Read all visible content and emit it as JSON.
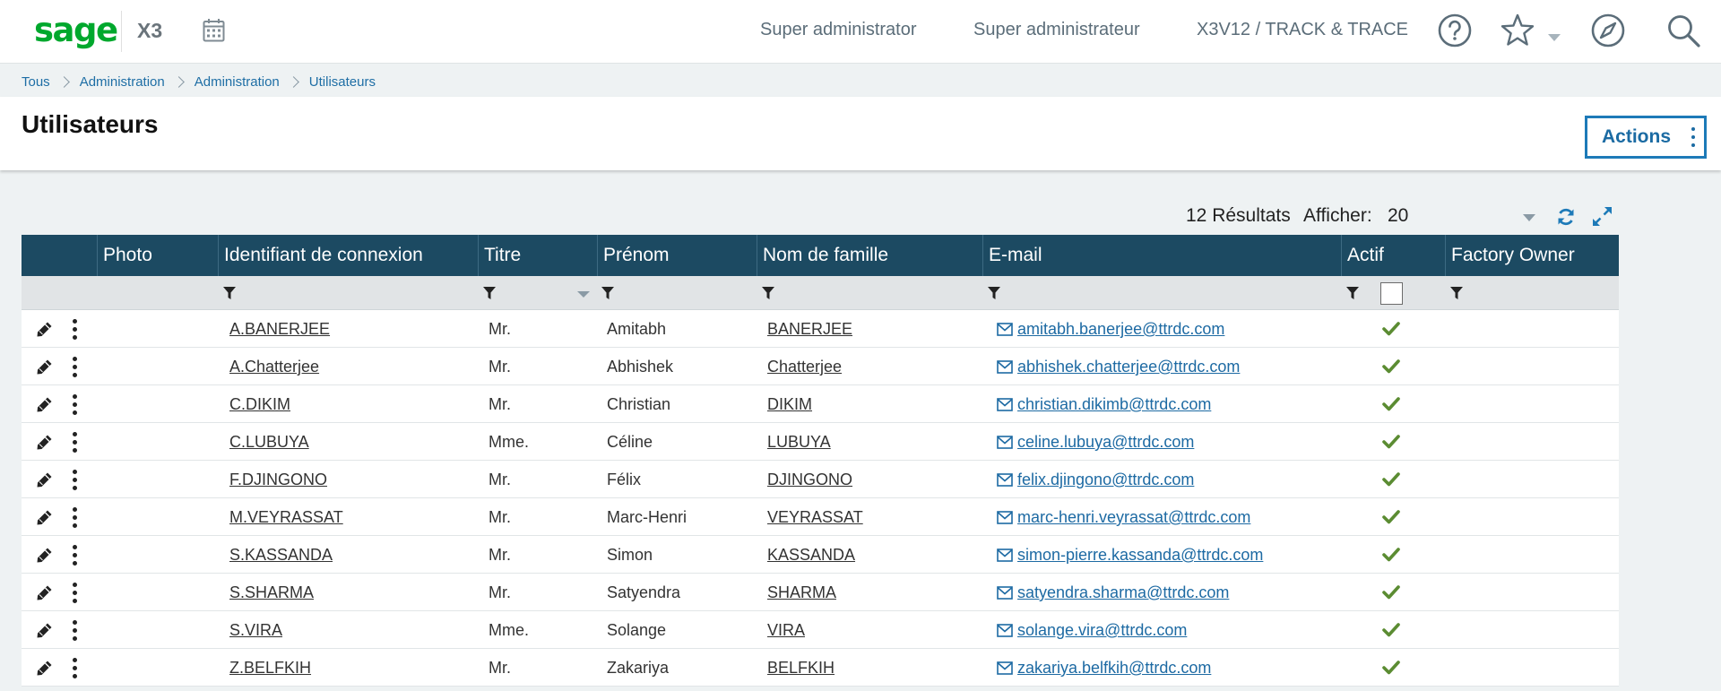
{
  "app": {
    "logo": "sage",
    "name": "X3"
  },
  "topbar": {
    "user": "Super administrator",
    "role": "Super administrateur",
    "endpoint": "X3V12 / TRACK & TRACE"
  },
  "breadcrumb": [
    "Tous",
    "Administration",
    "Administration",
    "Utilisateurs"
  ],
  "page": {
    "title": "Utilisateurs",
    "actions_label": "Actions"
  },
  "results": {
    "count_label": "12 Résultats",
    "show_label": "Afficher:",
    "show_value": "20"
  },
  "columns": [
    "Photo",
    "Identifiant de connexion",
    "Titre",
    "Prénom",
    "Nom de famille",
    "E-mail",
    "Actif",
    "Factory Owner"
  ],
  "rows": [
    {
      "login": "A.BANERJEE",
      "title": "Mr.",
      "first": "Amitabh",
      "last": "BANERJEE",
      "email": "amitabh.banerjee@ttrdc.com",
      "active": true
    },
    {
      "login": "A.Chatterjee",
      "title": "Mr.",
      "first": "Abhishek",
      "last": "Chatterjee",
      "email": "abhishek.chatterjee@ttrdc.com",
      "active": true
    },
    {
      "login": "C.DIKIM",
      "title": "Mr.",
      "first": "Christian",
      "last": "DIKIM",
      "email": "christian.dikimb@ttrdc.com",
      "active": true
    },
    {
      "login": "C.LUBUYA",
      "title": "Mme.",
      "first": "Céline",
      "last": "LUBUYA",
      "email": "celine.lubuya@ttrdc.com",
      "active": true
    },
    {
      "login": "F.DJINGONO",
      "title": "Mr.",
      "first": "Félix",
      "last": "DJINGONO",
      "email": "felix.djingono@ttrdc.com",
      "active": true
    },
    {
      "login": "M.VEYRASSAT",
      "title": "Mr.",
      "first": "Marc-Henri",
      "last": "VEYRASSAT",
      "email": "marc-henri.veyrassat@ttrdc.com",
      "active": true
    },
    {
      "login": "S.KASSANDA",
      "title": "Mr.",
      "first": "Simon",
      "last": "KASSANDA",
      "email": "simon-pierre.kassanda@ttrdc.com",
      "active": true
    },
    {
      "login": "S.SHARMA",
      "title": "Mr.",
      "first": "Satyendra",
      "last": "SHARMA",
      "email": "satyendra.sharma@ttrdc.com",
      "active": true
    },
    {
      "login": "S.VIRA",
      "title": "Mme.",
      "first": "Solange",
      "last": "VIRA",
      "email": "solange.vira@ttrdc.com",
      "active": true
    },
    {
      "login": "Z.BELFKIH",
      "title": "Mr.",
      "first": "Zakariya",
      "last": "BELFKIH",
      "email": "zakariya.belfkih@ttrdc.com",
      "active": true
    }
  ],
  "colors": {
    "brand": "#00a82d",
    "header": "#1c4a62",
    "link": "#1d6aa3",
    "check": "#5b8c32"
  },
  "icons": [
    "calendar-icon",
    "help-icon",
    "star-icon",
    "compass-icon",
    "search-icon",
    "refresh-icon",
    "fullscreen-icon",
    "funnel-icon",
    "pencil-icon",
    "more-icon",
    "envelope-icon",
    "check-icon"
  ]
}
